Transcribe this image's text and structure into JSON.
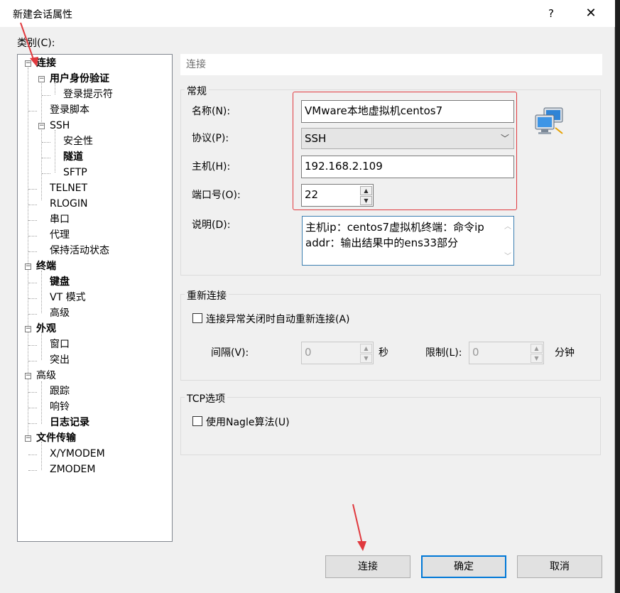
{
  "window": {
    "title": "新建会话属性",
    "help": "?",
    "close": "✕"
  },
  "category_label": "类别(C):",
  "tree": {
    "items": [
      {
        "label": "连接",
        "bold": true
      },
      {
        "label": "用户身份验证",
        "bold": true
      },
      {
        "label": "登录提示符",
        "bold": false
      },
      {
        "label": "登录脚本",
        "bold": false
      },
      {
        "label": "SSH",
        "bold": false
      },
      {
        "label": "安全性",
        "bold": false
      },
      {
        "label": "隧道",
        "bold": true
      },
      {
        "label": "SFTP",
        "bold": false
      },
      {
        "label": "TELNET",
        "bold": false
      },
      {
        "label": "RLOGIN",
        "bold": false
      },
      {
        "label": "串口",
        "bold": false
      },
      {
        "label": "代理",
        "bold": false
      },
      {
        "label": "保持活动状态",
        "bold": false
      },
      {
        "label": "终端",
        "bold": true
      },
      {
        "label": "键盘",
        "bold": true
      },
      {
        "label": "VT 模式",
        "bold": false
      },
      {
        "label": "高级",
        "bold": false
      },
      {
        "label": "外观",
        "bold": true
      },
      {
        "label": "窗口",
        "bold": false
      },
      {
        "label": "突出",
        "bold": false
      },
      {
        "label": "高级",
        "bold": false
      },
      {
        "label": "跟踪",
        "bold": false
      },
      {
        "label": "响铃",
        "bold": false
      },
      {
        "label": "日志记录",
        "bold": true
      },
      {
        "label": "文件传输",
        "bold": true
      },
      {
        "label": "X/YMODEM",
        "bold": false
      },
      {
        "label": "ZMODEM",
        "bold": false
      }
    ]
  },
  "panel_header": "连接",
  "general": {
    "title": "常规",
    "name_label": "名称(N):",
    "name_value": "VMware本地虚拟机centos7",
    "protocol_label": "协议(P):",
    "protocol_value": "SSH",
    "host_label": "主机(H):",
    "host_value": "192.168.2.109",
    "port_label": "端口号(O):",
    "port_value": "22",
    "desc_label": "说明(D):",
    "desc_line1": "主机ip：centos7虚拟机终端：命令ip",
    "desc_line2": "addr：输出结果中的ens33部分"
  },
  "reconnect": {
    "title": "重新连接",
    "checkbox_label": "连接异常关闭时自动重新连接(A)",
    "interval_label": "间隔(V):",
    "interval_value": "0",
    "interval_unit": "秒",
    "limit_label": "限制(L):",
    "limit_value": "0",
    "limit_unit": "分钟"
  },
  "tcp": {
    "title": "TCP选项",
    "nagle_label": "使用Nagle算法(U)"
  },
  "buttons": {
    "connect": "连接",
    "ok": "确定",
    "cancel": "取消"
  },
  "colors": {
    "annotation_red": "#e0393e",
    "focus_blue": "#0078d7"
  }
}
